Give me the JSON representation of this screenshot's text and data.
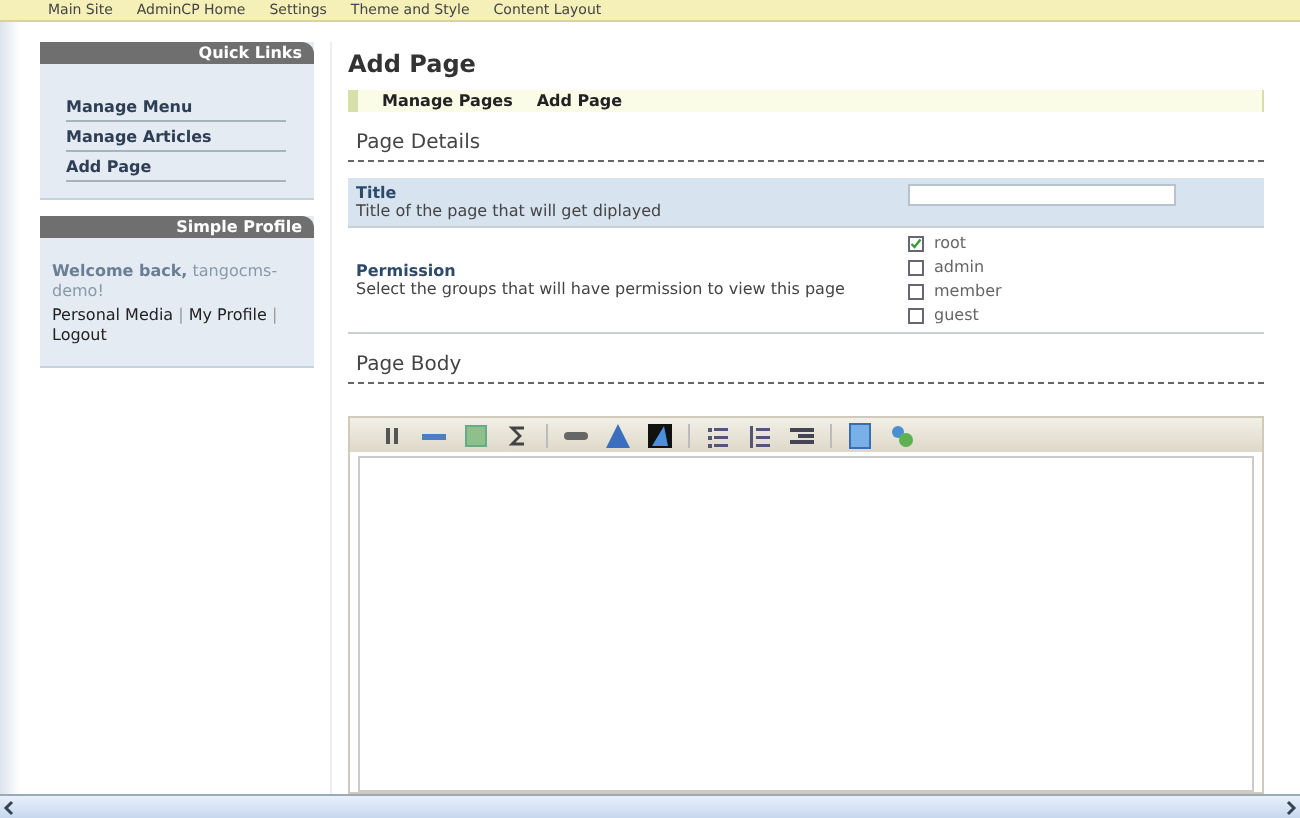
{
  "top_nav": [
    "Main Site",
    "AdminCP Home",
    "Settings",
    "Theme and Style",
    "Content Layout"
  ],
  "sidebar": {
    "quick_links": {
      "title": "Quick Links",
      "items": [
        "Manage Menu",
        "Manage Articles",
        "Add Page"
      ]
    },
    "simple_profile": {
      "title": "Simple Profile",
      "welcome": "Welcome back,",
      "username": "tangocms-demo!",
      "links": [
        "Personal Media",
        "My Profile",
        "Logout"
      ],
      "separator": "|"
    }
  },
  "content": {
    "title": "Add Page",
    "breadcrumb": [
      "Manage Pages",
      "Add Page"
    ],
    "page_details": {
      "heading": "Page Details",
      "title_field": {
        "label": "Title",
        "hint": "Title of the page that will get diplayed"
      },
      "permission": {
        "label": "Permission",
        "hint": "Select the groups that will have permission to view this page",
        "groups": [
          {
            "name": "root",
            "checked": true
          },
          {
            "name": "admin",
            "checked": false
          },
          {
            "name": "member",
            "checked": false
          },
          {
            "name": "guest",
            "checked": false
          }
        ]
      }
    },
    "page_body": {
      "heading": "Page Body"
    }
  }
}
